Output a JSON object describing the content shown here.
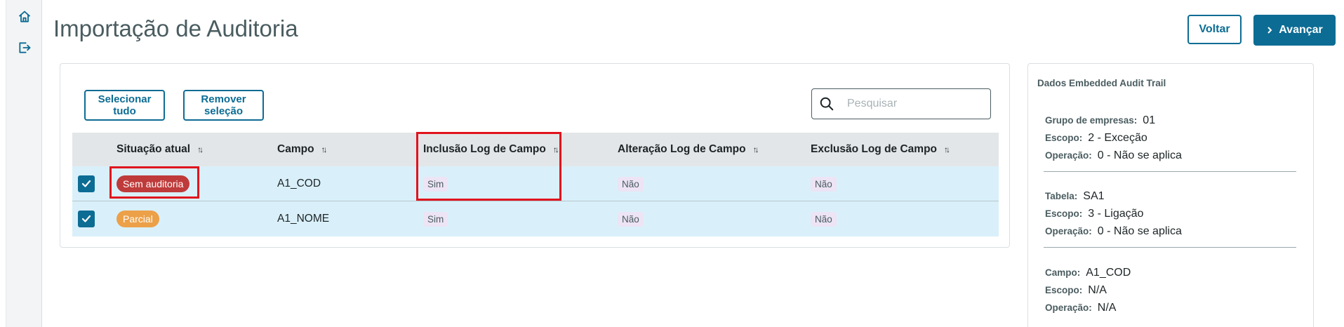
{
  "header": {
    "title": "Importação de Auditoria",
    "back_label": "Voltar",
    "next_label": "Avançar"
  },
  "toolbar": {
    "select_all": "Selecionar tudo",
    "remove_selection": "Remover seleção",
    "search_placeholder": "Pesquisar"
  },
  "table": {
    "columns": [
      "Situação atual",
      "Campo",
      "Inclusão Log de Campo",
      "Alteração Log de Campo",
      "Exclusão Log de Campo"
    ],
    "rows": [
      {
        "status": "Sem auditoria",
        "field": "A1_COD",
        "inclusion": "Sim",
        "alteration": "Não",
        "exclusion": "Não"
      },
      {
        "status": "Parcial",
        "field": "A1_NOME",
        "inclusion": "Sim",
        "alteration": "Não",
        "exclusion": "Não"
      }
    ]
  },
  "panel": {
    "title": "Dados Embedded Audit Trail",
    "group1": {
      "k1": "Grupo de empresas:",
      "v1": "01",
      "k2": "Escopo:",
      "v2": "2 - Exceção",
      "k3": "Operação:",
      "v3": "0 - Não se aplica"
    },
    "group2": {
      "k1": "Tabela:",
      "v1": "SA1",
      "k2": "Escopo:",
      "v2": "3 - Ligação",
      "k3": "Operação:",
      "v3": "0 - Não se aplica"
    },
    "group3": {
      "k1": "Campo:",
      "v1": "A1_COD",
      "k2": "Escopo:",
      "v2": "N/A",
      "k3": "Operação:",
      "v3": "N/A"
    }
  },
  "colors": {
    "primary": "#0c6c94",
    "badge_red": "#bf3a3a",
    "badge_orange": "#eca048",
    "row_bg": "#d9f0fa",
    "highlight": "#e0141e"
  },
  "icons": {
    "home": "home-icon",
    "logout": "logout-icon",
    "search": "search-icon",
    "chevron": "chevron-right-icon",
    "check": "check-icon",
    "sort": "sort-icon"
  }
}
